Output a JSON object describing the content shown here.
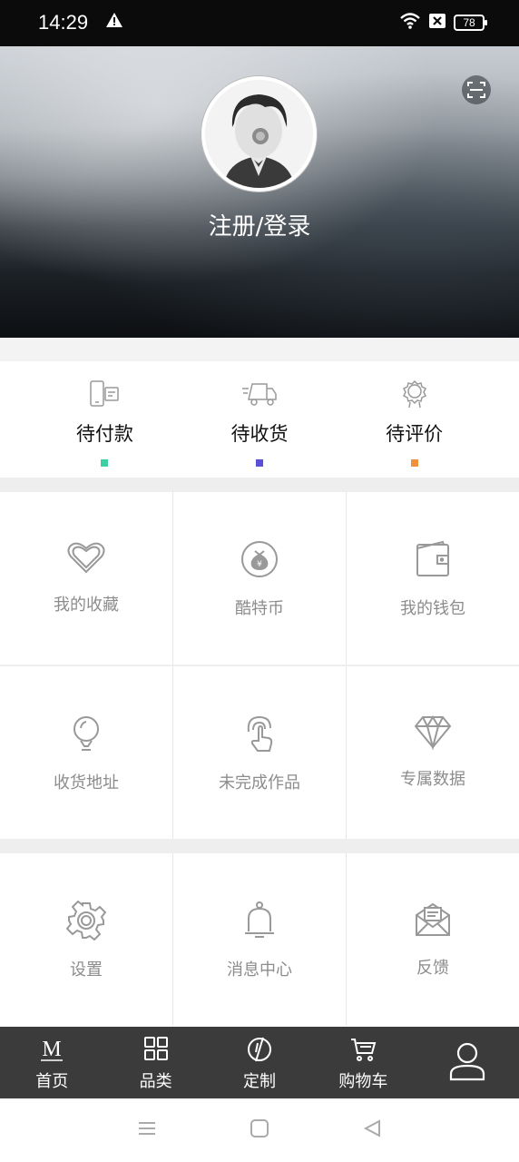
{
  "status_bar": {
    "time": "14:29",
    "battery": "78"
  },
  "profile": {
    "login_label": "注册/登录"
  },
  "orders": [
    {
      "label": "待付款",
      "color": "#3fcfa4"
    },
    {
      "label": "待收货",
      "color": "#5a4fd6"
    },
    {
      "label": "待评价",
      "color": "#f0913d"
    }
  ],
  "features_row1": [
    {
      "label": "我的收藏",
      "icon": "heart-icon"
    },
    {
      "label": "酷特币",
      "icon": "coin-bag-icon"
    },
    {
      "label": "我的钱包",
      "icon": "wallet-icon"
    }
  ],
  "features_row2": [
    {
      "label": "收货地址",
      "icon": "location-pin-icon"
    },
    {
      "label": "未完成作品",
      "icon": "touch-icon"
    },
    {
      "label": "专属数据",
      "icon": "diamond-icon"
    }
  ],
  "features_row3": [
    {
      "label": "设置",
      "icon": "gear-icon"
    },
    {
      "label": "消息中心",
      "icon": "bell-icon"
    },
    {
      "label": "反馈",
      "icon": "mail-icon"
    }
  ],
  "tabbar": [
    {
      "label": "首页",
      "icon": "home-m-icon"
    },
    {
      "label": "品类",
      "icon": "grid-icon"
    },
    {
      "label": "定制",
      "icon": "custom-icon"
    },
    {
      "label": "购物车",
      "icon": "cart-icon"
    },
    {
      "label": "",
      "icon": "person-icon"
    }
  ]
}
